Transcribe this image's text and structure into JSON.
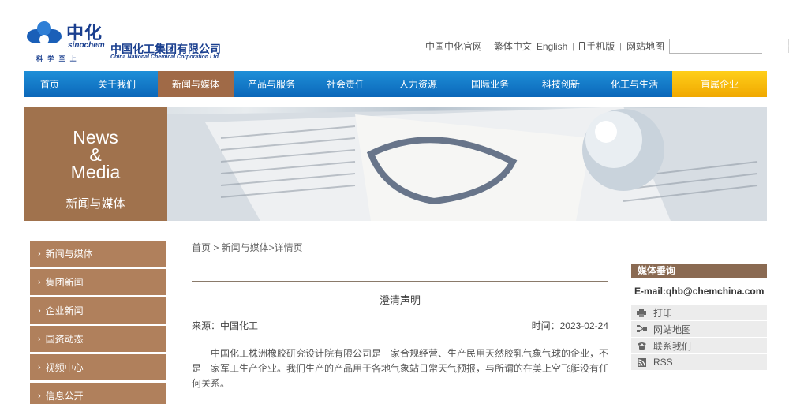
{
  "logo": {
    "cn_short": "中化",
    "en_short": "sinochem",
    "slogan": "科 学 至 上",
    "cn_full": "中国化工集团有限公司",
    "en_full": "China National Chemical Corporation Ltd."
  },
  "toplinks": {
    "official": "中国中化官网",
    "traditional": "繁体中文",
    "english": "English",
    "mobile": "手机版",
    "sitemap": "网站地图",
    "sep": "|"
  },
  "search": {
    "placeholder": "",
    "value": ""
  },
  "nav": [
    {
      "label": "首页"
    },
    {
      "label": "关于我们"
    },
    {
      "label": "新闻与媒体"
    },
    {
      "label": "产品与服务"
    },
    {
      "label": "社会责任"
    },
    {
      "label": "人力资源"
    },
    {
      "label": "国际业务"
    },
    {
      "label": "科技创新"
    },
    {
      "label": "化工与生活"
    },
    {
      "label": "直属企业"
    }
  ],
  "banner": {
    "en_line1": "News",
    "en_line2": "&",
    "en_line3": "Media",
    "cn": "新闻与媒体"
  },
  "sidebar": [
    {
      "label": "新闻与媒体"
    },
    {
      "label": "集团新闻"
    },
    {
      "label": "企业新闻"
    },
    {
      "label": "国资动态"
    },
    {
      "label": "视频中心"
    },
    {
      "label": "信息公开"
    }
  ],
  "article": {
    "breadcrumb": "首页 > 新闻与媒体>详情页",
    "title": "澄清声明",
    "source": "来源：中国化工",
    "time": "时间：2023-02-24",
    "body": "中国化工株洲橡胶研究设计院有限公司是一家合规经营、生产民用天然胶乳气象气球的企业，不是一家军工生产企业。我们生产的产品用于各地气象站日常天气预报，与所谓的在美上空飞艇没有任何关系。"
  },
  "right_panel": {
    "heading": "媒体垂询",
    "email": "E-mail:qhb@chemchina.com",
    "links": [
      {
        "label": "打印",
        "icon": "printer-icon"
      },
      {
        "label": "网站地图",
        "icon": "sitemap-icon"
      },
      {
        "label": "联系我们",
        "icon": "phone-icon"
      },
      {
        "label": "RSS",
        "icon": "rss-icon"
      }
    ]
  },
  "colors": {
    "brand_blue": "#1a3f8f",
    "nav_blue": "#1e8fd8",
    "nav_active": "#a06a47",
    "nav_gold": "#f0a800",
    "sidebar_brown": "#b0805c"
  }
}
